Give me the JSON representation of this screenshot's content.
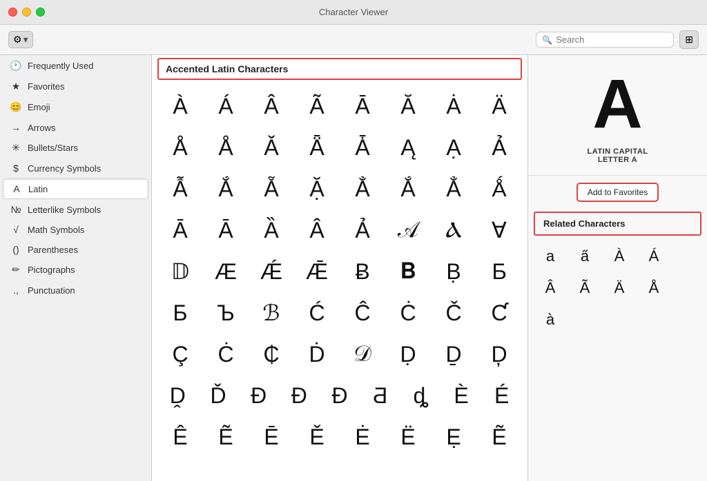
{
  "titlebar": {
    "title": "Character Viewer"
  },
  "toolbar": {
    "gear_label": "⚙",
    "chevron": "▾",
    "search_placeholder": "Search",
    "grid_icon": "⊞"
  },
  "sidebar": {
    "items": [
      {
        "id": "frequently-used",
        "icon": "🕐",
        "label": "Frequently Used"
      },
      {
        "id": "favorites",
        "icon": "★",
        "label": "Favorites"
      },
      {
        "id": "emoji",
        "icon": "😊",
        "label": "Emoji"
      },
      {
        "id": "arrows",
        "icon": "→",
        "label": "Arrows"
      },
      {
        "id": "bullets-stars",
        "icon": "✳",
        "label": "Bullets/Stars"
      },
      {
        "id": "currency",
        "icon": "$",
        "label": "Currency Symbols"
      },
      {
        "id": "latin",
        "icon": "A",
        "label": "Latin",
        "active": true
      },
      {
        "id": "letterlike",
        "icon": "№",
        "label": "Letterlike Symbols"
      },
      {
        "id": "math",
        "icon": "√",
        "label": "Math Symbols"
      },
      {
        "id": "parentheses",
        "icon": "()",
        "label": "Parentheses"
      },
      {
        "id": "pictographs",
        "icon": "✏",
        "label": "Pictographs"
      },
      {
        "id": "punctuation",
        "icon": ".,",
        "label": "Punctuation"
      }
    ]
  },
  "char_section": {
    "header": "Accented Latin Characters"
  },
  "characters": {
    "rows": [
      [
        "À",
        "Á",
        "Â",
        "Ã",
        "Ā",
        "Ă",
        "Ȧ",
        "Ä"
      ],
      [
        "Å",
        "Å",
        "Ǎ",
        "Ǟ",
        "Ǡ",
        "Ą",
        "Ạ",
        "Ả"
      ],
      [
        "Ẫ",
        "Ắ",
        "Ẵ",
        "Ặ",
        "Ẳ",
        "Ắ",
        "Ẳ",
        "Ǻ"
      ],
      [
        "Ā",
        "Ā",
        "Ȁ",
        "Â",
        "Ả",
        "𝒜",
        "Ⲁ",
        "∀"
      ],
      [
        "𝔻",
        "Æ",
        "Ǽ",
        "Ǣ",
        "Ƀ",
        "𝐁",
        "Ḅ",
        "Ƃ"
      ],
      [
        "Б",
        "Ъ",
        "ℬ",
        "Ć",
        "Ĉ",
        "Ċ",
        "Č",
        "Ƈ"
      ],
      [
        "Ç",
        "Ċ",
        "₵",
        "Ḋ",
        "𝒟",
        "Ḍ",
        "Ḏ",
        "Ḑ"
      ],
      [
        "Ḓ",
        "Ď",
        "Ð",
        "Đ",
        "Ɖ",
        "Ƌ",
        "ȡ",
        "È",
        "É"
      ],
      [
        "Ê",
        "Ẽ",
        "Ē",
        "Ě",
        "Ė",
        "Ë",
        "Ẹ",
        "Ẽ"
      ]
    ]
  },
  "right_panel": {
    "preview_char": "A",
    "char_name": "LATIN CAPITAL\nLETTER A",
    "add_favorites_label": "Add to Favorites",
    "related_header": "Related Characters",
    "related_chars": [
      "a",
      "a̋",
      "À",
      "Á",
      "Â",
      "Ã",
      "Ä",
      "Å",
      "à"
    ]
  }
}
